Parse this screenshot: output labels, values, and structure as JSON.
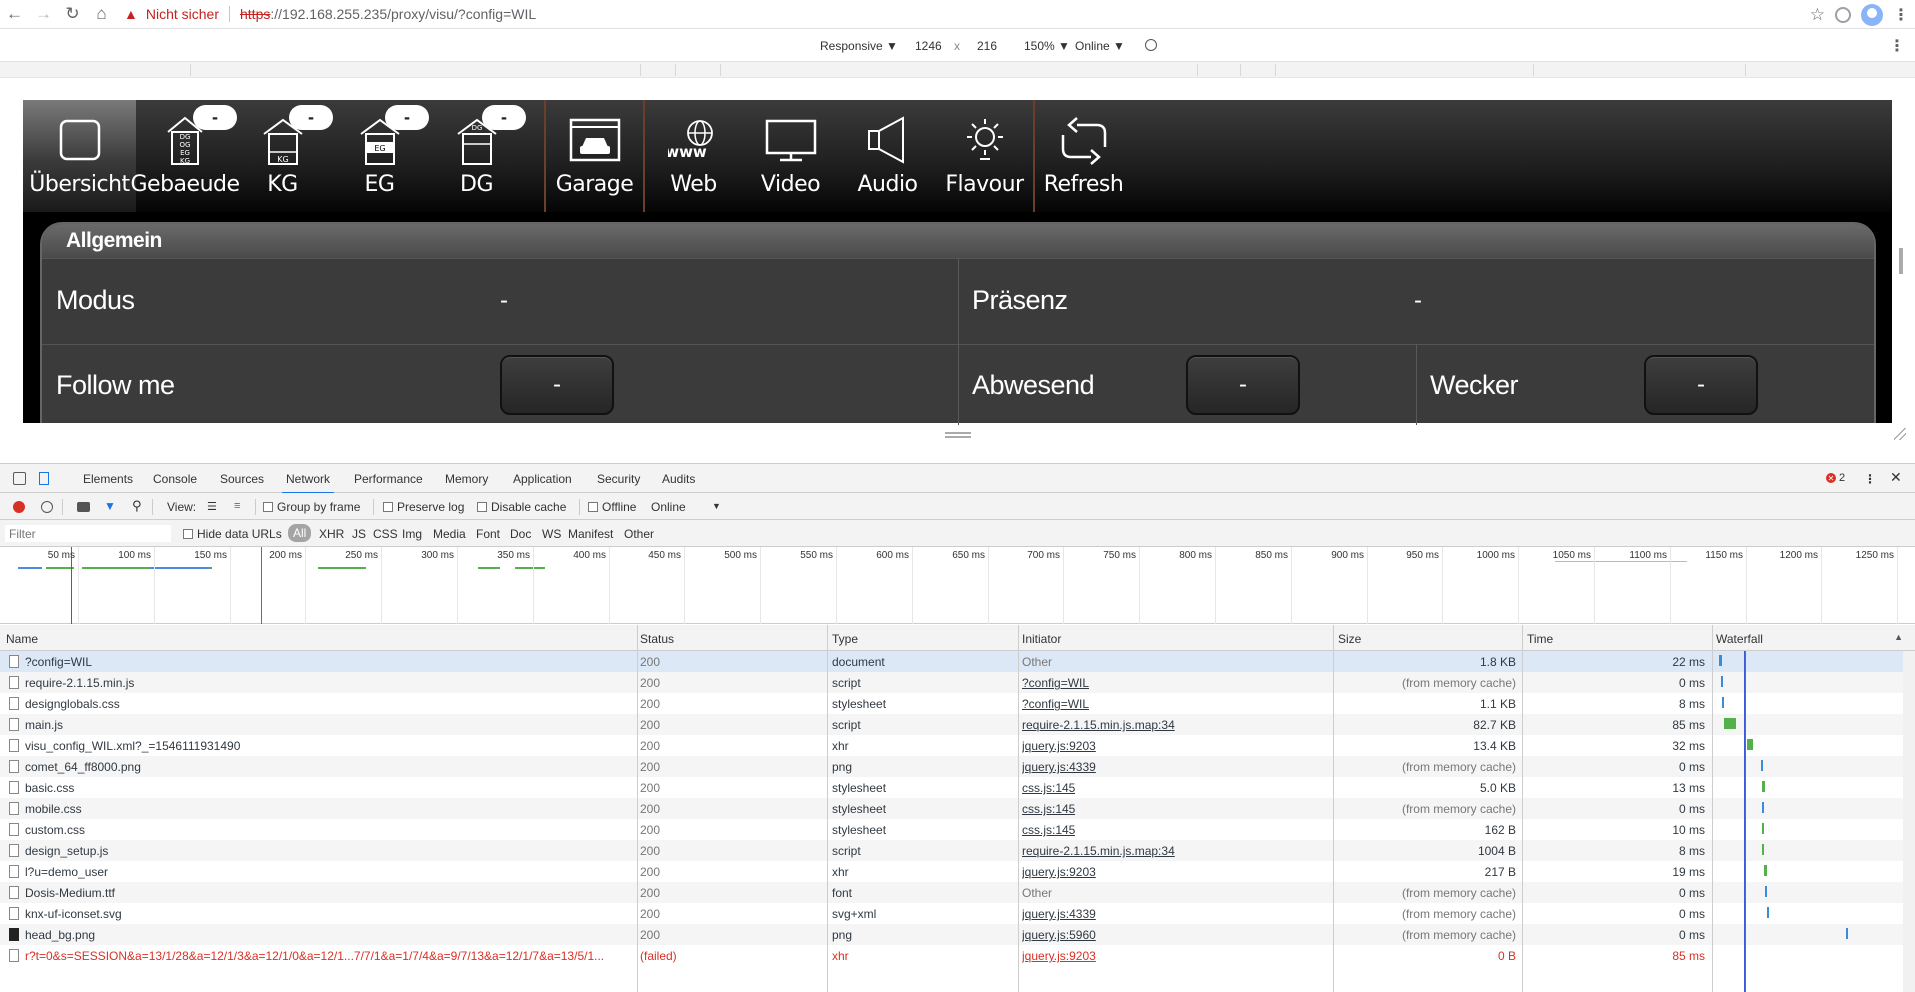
{
  "browser": {
    "warning_text": "Nicht sicher",
    "url_scheme": "https",
    "url_rest": "://192.168.255.235/proxy/visu/?config=WIL"
  },
  "device_toolbar": {
    "device": "Responsive ▼",
    "width": "1246",
    "times": "x",
    "height": "216",
    "zoom": "150% ▼",
    "network": "Online ▼"
  },
  "visu": {
    "nav": [
      {
        "label": "Übersicht",
        "icon": "square-icon"
      },
      {
        "label": "Gebaeude",
        "icon": "building-icon",
        "badge": "-"
      },
      {
        "label": "KG",
        "icon": "house-kg-icon",
        "badge": "-"
      },
      {
        "label": "EG",
        "icon": "house-eg-icon",
        "badge": "-"
      },
      {
        "label": "DG",
        "icon": "house-dg-icon",
        "badge": "-"
      },
      {
        "label": "Garage",
        "icon": "garage-icon"
      },
      {
        "label": "Web",
        "icon": "globe-www-icon"
      },
      {
        "label": "Video",
        "icon": "monitor-icon"
      },
      {
        "label": "Audio",
        "icon": "speaker-icon"
      },
      {
        "label": "Flavour",
        "icon": "sun-bulb-icon"
      },
      {
        "label": "Refresh",
        "icon": "refresh-icon"
      }
    ],
    "icon_text": {
      "gebaeude": [
        "DG",
        "OG",
        "EG",
        "KG"
      ],
      "kg": "KG",
      "eg": "EG",
      "dg": "DG",
      "web": "www"
    },
    "panel_title": "Allgemein",
    "modus_label": "Modus",
    "modus_value": "-",
    "praesenz_label": "Präsenz",
    "praesenz_value": "-",
    "follow_label": "Follow me",
    "follow_button": "-",
    "abwesend_label": "Abwesend",
    "abwesend_button": "-",
    "wecker_label": "Wecker",
    "wecker_button": "-"
  },
  "devtools": {
    "tabs": [
      "Elements",
      "Console",
      "Sources",
      "Network",
      "Performance",
      "Memory",
      "Application",
      "Security",
      "Audits"
    ],
    "active_tab": "Network",
    "error_count": "2",
    "toolbar": {
      "view_label": "View:",
      "group_by_frame": "Group by frame",
      "preserve_log": "Preserve log",
      "disable_cache": "Disable cache",
      "offline": "Offline",
      "throttle": "Online"
    },
    "filter": {
      "placeholder": "Filter",
      "hide_data_urls": "Hide data URLs",
      "types": [
        "All",
        "XHR",
        "JS",
        "CSS",
        "Img",
        "Media",
        "Font",
        "Doc",
        "WS",
        "Manifest",
        "Other"
      ]
    },
    "overview_ticks": [
      "50 ms",
      "100 ms",
      "150 ms",
      "200 ms",
      "250 ms",
      "300 ms",
      "350 ms",
      "400 ms",
      "450 ms",
      "500 ms",
      "550 ms",
      "600 ms",
      "650 ms",
      "700 ms",
      "750 ms",
      "800 ms",
      "850 ms",
      "900 ms",
      "950 ms",
      "1000 ms",
      "1050 ms",
      "1100 ms",
      "1150 ms",
      "1200 ms",
      "1250 ms"
    ],
    "columns": [
      "Name",
      "Status",
      "Type",
      "Initiator",
      "Size",
      "Time",
      "Waterfall"
    ],
    "rows": [
      {
        "name": "?config=WIL",
        "status": "200",
        "type": "document",
        "initiator": "Other",
        "size": "1.8 KB",
        "time": "22 ms"
      },
      {
        "name": "require-2.1.15.min.js",
        "status": "200",
        "type": "script",
        "initiator": "?config=WIL",
        "size": "(from memory cache)",
        "time": "0 ms"
      },
      {
        "name": "designglobals.css",
        "status": "200",
        "type": "stylesheet",
        "initiator": "?config=WIL",
        "size": "1.1 KB",
        "time": "8 ms"
      },
      {
        "name": "main.js",
        "status": "200",
        "type": "script",
        "initiator": "require-2.1.15.min.js.map:34",
        "size": "82.7 KB",
        "time": "85 ms"
      },
      {
        "name": "visu_config_WIL.xml?_=1546111931490",
        "status": "200",
        "type": "xhr",
        "initiator": "jquery.js:9203",
        "size": "13.4 KB",
        "time": "32 ms"
      },
      {
        "name": "comet_64_ff8000.png",
        "status": "200",
        "type": "png",
        "initiator": "jquery.js:4339",
        "size": "(from memory cache)",
        "time": "0 ms"
      },
      {
        "name": "basic.css",
        "status": "200",
        "type": "stylesheet",
        "initiator": "css.js:145",
        "size": "5.0 KB",
        "time": "13 ms"
      },
      {
        "name": "mobile.css",
        "status": "200",
        "type": "stylesheet",
        "initiator": "css.js:145",
        "size": "(from memory cache)",
        "time": "0 ms"
      },
      {
        "name": "custom.css",
        "status": "200",
        "type": "stylesheet",
        "initiator": "css.js:145",
        "size": "162 B",
        "time": "10 ms"
      },
      {
        "name": "design_setup.js",
        "status": "200",
        "type": "script",
        "initiator": "require-2.1.15.min.js.map:34",
        "size": "1004 B",
        "time": "8 ms"
      },
      {
        "name": "l?u=demo_user",
        "status": "200",
        "type": "xhr",
        "initiator": "jquery.js:9203",
        "size": "217 B",
        "time": "19 ms"
      },
      {
        "name": "Dosis-Medium.ttf",
        "status": "200",
        "type": "font",
        "initiator": "Other",
        "size": "(from memory cache)",
        "time": "0 ms"
      },
      {
        "name": "knx-uf-iconset.svg",
        "status": "200",
        "type": "svg+xml",
        "initiator": "jquery.js:4339",
        "size": "(from memory cache)",
        "time": "0 ms"
      },
      {
        "name": "head_bg.png",
        "status": "200",
        "type": "png",
        "initiator": "jquery.js:5960",
        "size": "(from memory cache)",
        "time": "0 ms"
      },
      {
        "name": "r?t=0&s=SESSION&a=13/1/28&a=12/1/3&a=12/1/0&a=12/1...7/7/1&a=1/7/4&a=9/7/13&a=12/1/7&a=13/5/1...",
        "status": "(failed)",
        "type": "xhr",
        "initiator": "jquery.js:9203",
        "size": "0 B",
        "time": "85 ms"
      }
    ]
  },
  "colors": {
    "accent": "#1a73e8",
    "error": "#d93025",
    "visu_bg": "#3b3b3b",
    "nav_separator": "#6b3f2b"
  }
}
